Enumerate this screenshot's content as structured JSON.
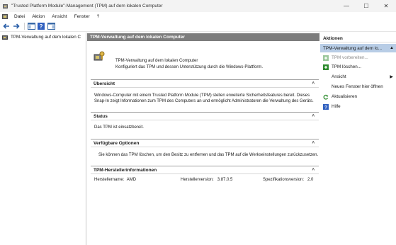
{
  "window": {
    "title": "\"Trusted Platform Module\"-Management (TPM) auf dem lokalen Computer",
    "minimize": "—",
    "maximize": "☐",
    "close": "✕"
  },
  "menu": {
    "items": [
      "Datei",
      "Aktion",
      "Ansicht",
      "Fenster",
      "?"
    ]
  },
  "toolbar": {
    "icons": [
      "back-arrow-icon",
      "forward-arrow-icon",
      "show-hide-console-tree-icon",
      "help-icon",
      "properties-icon"
    ]
  },
  "tree": {
    "root_label": "TPM-Verwaltung auf dem lokalen C"
  },
  "center": {
    "header": "TPM-Verwaltung auf dem lokalen Computer",
    "intro_title": "TPM-Verwaltung auf dem lokalen Computer",
    "intro_desc": "Konfiguriert das TPM und dessen Unterstützung durch die Windows-Plattform.",
    "sections": {
      "overview": {
        "title": "Übersicht",
        "lines": [
          "Windows-Computer mit einem Trusted Platform Module (TPM) stellen erweiterte Sicherheitsfeatures bereit. Dieses",
          "Snap-In zeigt Informationen zum TPM des Computers an und ermöglicht Administratoren die Verwaltung des Geräts."
        ]
      },
      "status": {
        "title": "Status",
        "text": "Das TPM ist einsatzbereit."
      },
      "options": {
        "title": "Verfügbare Optionen",
        "text": "Sie können das TPM löschen, um den Besitz zu entfernen und das TPM auf die Werkseinstellungen zurückzusetzen."
      },
      "manufacturer": {
        "title": "TPM-Herstellerinformationen",
        "name_label": "Herstellername:",
        "name_value": "AMD",
        "version_label": "Herstellerversion:",
        "version_value": "3.87.0.5",
        "spec_label": "Spezifikationsversion:",
        "spec_value": "2.0"
      }
    },
    "collapse_glyph": "˄"
  },
  "actions": {
    "title": "Aktionen",
    "context": "TPM-Verwaltung auf dem lo...",
    "items": [
      {
        "label": "TPM vorbereiten...",
        "icon": "tpm-prepare-icon",
        "disabled": true
      },
      {
        "label": "TPM löschen...",
        "icon": "tpm-clear-icon",
        "disabled": false
      },
      {
        "label": "Ansicht",
        "icon": "",
        "disabled": false,
        "submenu": true
      },
      {
        "label": "Neues Fenster hier öffnen",
        "icon": "",
        "disabled": false
      },
      {
        "label": "Aktualisieren",
        "icon": "refresh-icon",
        "disabled": false
      },
      {
        "label": "Hilfe",
        "icon": "help-icon",
        "disabled": false
      }
    ],
    "submenu_arrow": "▶",
    "context_arrow": "▲"
  },
  "colors": {
    "header_gray": "#7d7d7d",
    "selection_blue": "#b8cde6",
    "action_green": "#2e8b2e",
    "help_blue": "#3060c0"
  }
}
